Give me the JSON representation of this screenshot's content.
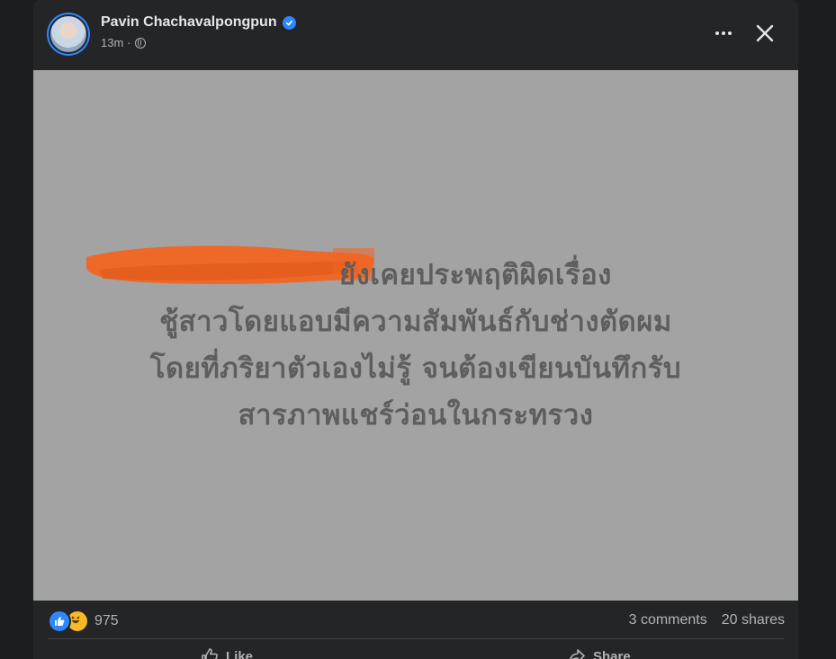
{
  "post": {
    "author_name": "Pavin Chachavalpongpun",
    "timestamp": "13m",
    "separator": "·",
    "image_text_lines": [
      "ยังเคยประพฤติผิดเรื่อง",
      "ชู้สาวโดยแอบมีความสัมพันธ์กับช่างตัดผม",
      "โดยที่ภริยาตัวเองไม่รู้ จนต้องเขียนบันทึกรับ",
      "สารภาพแชร์ว่อนในกระทรวง"
    ],
    "image_background": "#a3a3a3",
    "redaction_color": "#f26522"
  },
  "stats": {
    "reaction_count": "975",
    "comments": "3 comments",
    "shares": "20 shares"
  },
  "actions": {
    "like_label": "Like",
    "share_label": "Share"
  },
  "icons": {
    "verified": "verified-badge-icon",
    "privacy": "globe-icon",
    "more": "more-options-icon",
    "close": "close-icon",
    "like_reaction": "like-reaction-icon",
    "haha_reaction": "haha-reaction-icon"
  },
  "colors": {
    "accent": "#2d88ff",
    "card_bg": "#242526",
    "text_primary": "#e4e6eb",
    "text_secondary": "#b0b3b8"
  }
}
